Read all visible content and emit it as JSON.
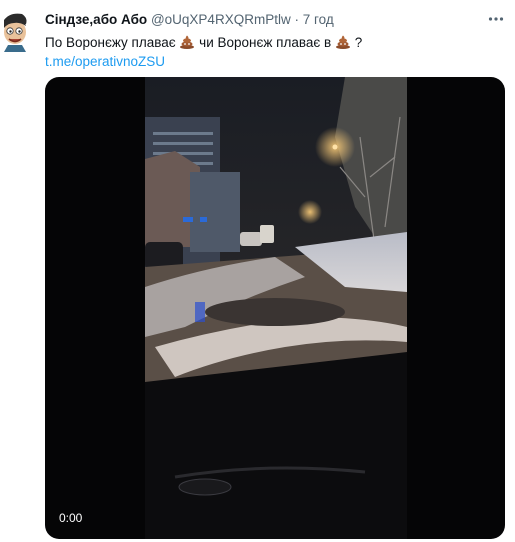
{
  "tweet": {
    "author_name": "Сіндзе,або Або",
    "handle": "@oUqXP4RXQRmPtlw",
    "separator": "·",
    "time": "7 год",
    "text_part1": "По Воронєжу плаває",
    "text_part2": "чи Воронєж плаває в",
    "text_part3": "?",
    "link": "t.me/operativnoZSU",
    "more_icon": "more-dots-icon"
  },
  "video": {
    "timecode": "0:00"
  },
  "colors": {
    "text": "#0f1419",
    "secondary": "#536471",
    "link": "#1d9bf0",
    "video_bg": "#050506"
  }
}
